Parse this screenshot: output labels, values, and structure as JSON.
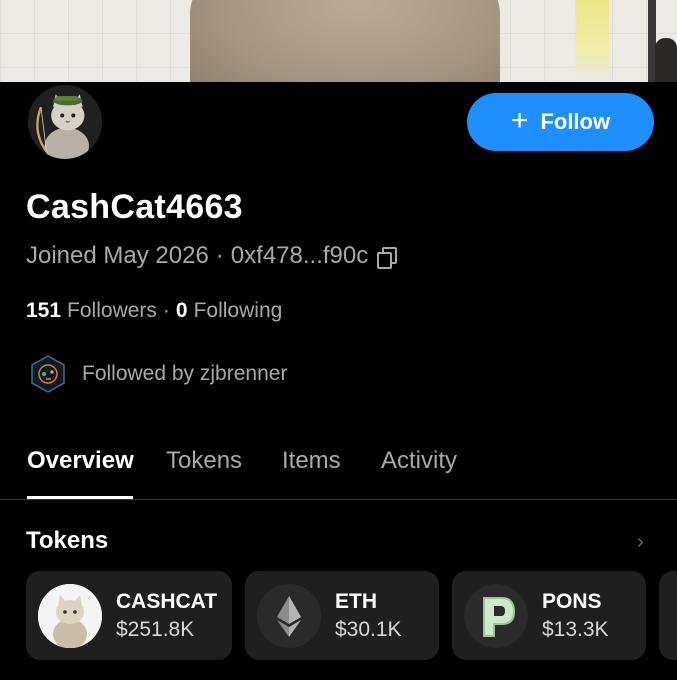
{
  "profile": {
    "username": "CashCat4663",
    "joined": "Joined May 2026",
    "address": "0xf478...f90c",
    "followers_count": "151",
    "followers_label": "Followers",
    "following_count": "0",
    "following_label": "Following",
    "followed_by": "Followed by zjbrenner"
  },
  "follow_button": {
    "label": "Follow"
  },
  "tabs": [
    {
      "label": "Overview",
      "active": true
    },
    {
      "label": "Tokens"
    },
    {
      "label": "Items"
    },
    {
      "label": "Activity"
    }
  ],
  "tokens_section": {
    "title": "Tokens",
    "items": [
      {
        "symbol": "CASHCAT",
        "value": "$251.8K",
        "icon": "cashcat-token-icon"
      },
      {
        "symbol": "ETH",
        "value": "$30.1K",
        "icon": "eth-token-icon"
      },
      {
        "symbol": "PONS",
        "value": "$13.3K",
        "icon": "pons-token-icon"
      }
    ]
  },
  "colors": {
    "accent": "#1f8fff",
    "background": "#000000",
    "card": "#1f1f1f",
    "muted_text": "#a9a9a9"
  }
}
